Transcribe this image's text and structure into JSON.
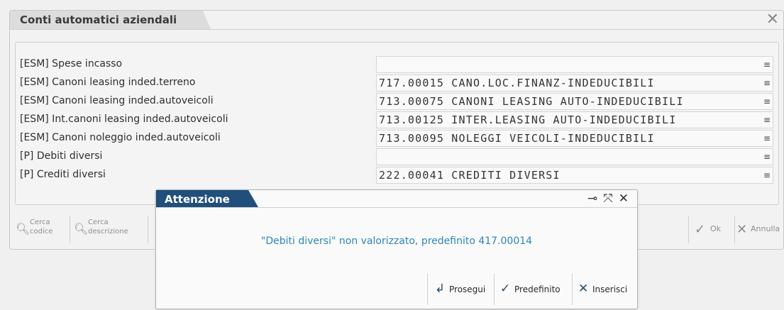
{
  "window": {
    "title": "Conti automatici aziendali",
    "close_icon": "close-icon"
  },
  "rows": [
    {
      "label": "[ESM] Spese incasso",
      "value": ""
    },
    {
      "label": "[ESM] Canoni leasing inded.terreno",
      "value": "717.00015 CANO.LOC.FINANZ-INDEDUCIBILI"
    },
    {
      "label": "[ESM] Canoni leasing inded.autoveicoli",
      "value": "713.00075 CANONI LEASING AUTO-INDEDUCIBILI"
    },
    {
      "label": "[ESM] Int.canoni leasing inded.autoveicoli",
      "value": "713.00125 INTER.LEASING AUTO-INDEDUCIBILI"
    },
    {
      "label": "[ESM] Canoni noleggio inded.autoveicoli",
      "value": "713.00095 NOLEGGI VEICOLI-INDEDUCIBILI"
    },
    {
      "label": "[P] Debiti diversi",
      "value": ""
    },
    {
      "label": "[P] Crediti diversi",
      "value": "222.00041 CREDITI DIVERSI"
    }
  ],
  "toolbar": {
    "search_code": {
      "line1": "Cerca",
      "line2": "codice"
    },
    "search_desc": {
      "line1": "Cerca",
      "line2": "descrizione"
    },
    "ok_label": "Ok",
    "cancel_label": "Annulla"
  },
  "dialog": {
    "title": "Attenzione",
    "message": "\"Debiti diversi\" non valorizzato, predefinito 417.00014",
    "buttons": {
      "proceed": "Prosegui",
      "default": "Predefinito",
      "insert": "Inserisci"
    }
  },
  "colors": {
    "dialog_title_bg": "#1f4f7a",
    "message_text": "#2b87b8"
  }
}
